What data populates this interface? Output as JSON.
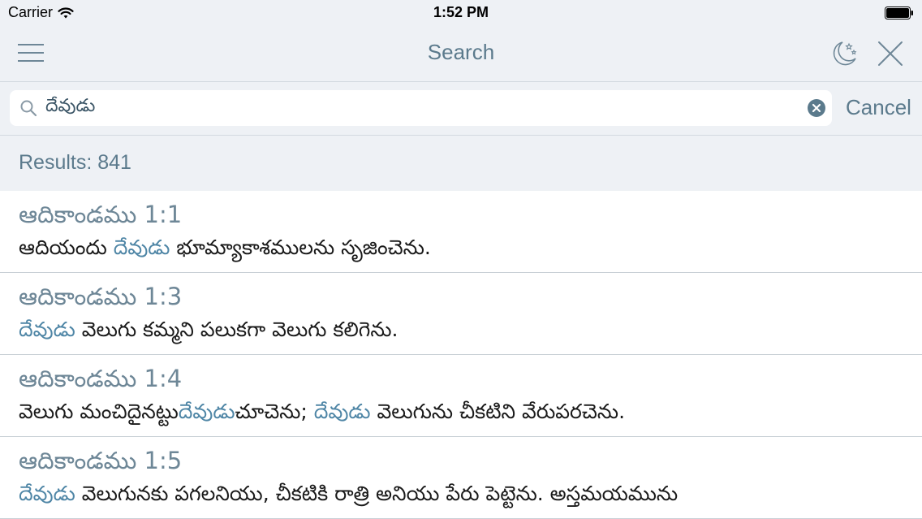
{
  "status_bar": {
    "carrier": "Carrier",
    "time": "1:52 PM"
  },
  "nav": {
    "title": "Search",
    "menu_icon": "hamburger-menu-icon",
    "night_icon": "moon-stars-icon",
    "close_icon": "close-icon"
  },
  "search": {
    "value": "దేవుడు",
    "cancel_label": "Cancel"
  },
  "results": {
    "count_label": "Results: 841",
    "items": [
      {
        "ref": "ఆదికాండము 1:1",
        "text_before": "ఆదియందు ",
        "highlight": "దేవుడు",
        "text_after": " భూమ్యాకాశములను సృజించెను."
      },
      {
        "ref": "ఆదికాండము 1:3",
        "text_before": "",
        "highlight": "దేవుడు",
        "text_after": " వెలుగు కమ్మని పలుకగా వెలుగు కలిగెను."
      },
      {
        "ref": "ఆదికాండము 1:4",
        "text_before": "వెలుగు మంచిదైనట్టు",
        "highlight": "దేవుడు",
        "text_mid": "చూచెను; ",
        "highlight2": "దేవుడు",
        "text_after": " వెలుగును చీకటిని వేరుపరచెను."
      },
      {
        "ref": "ఆదికాండము 1:5",
        "text_before": "",
        "highlight": "దేవుడు",
        "text_after": " వెలుగునకు పగలనియు, చీకటికి రాత్రి అనియు పేరు పెట్టెను. అస్తమయమును"
      }
    ]
  },
  "colors": {
    "accent": "#5b7a8c",
    "highlight": "#4f86a6",
    "bar_bg": "#eef1f5"
  }
}
